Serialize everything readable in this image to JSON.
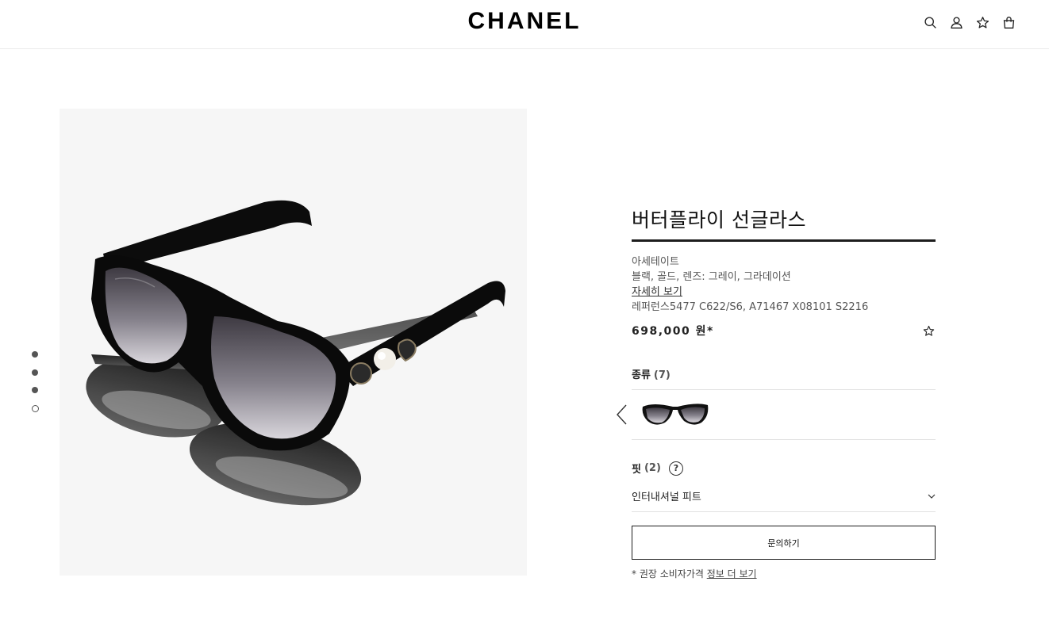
{
  "header": {
    "logo": "CHANEL",
    "icons": [
      "search-icon",
      "account-icon",
      "wishlist-star-icon",
      "shopping-bag-icon"
    ]
  },
  "gallery": {
    "dot_count": 4,
    "active_index": 3,
    "image_alt_icon": "sunglasses-image"
  },
  "product": {
    "title": "버터플라이 선글라스",
    "material": "아세테이트",
    "colors": "블랙, 골드, 렌즈: 그레이, 그라데이션",
    "details_link": "자세히 보기",
    "reference": "레퍼런스5477 C622/S6, A71467 X08101 S2216",
    "price": "698,000 원*"
  },
  "variants": {
    "label": "종류",
    "count": "(7)"
  },
  "fit": {
    "label": "핏",
    "count": "(2)",
    "help": "?",
    "selected": "인터내셔널 피트"
  },
  "actions": {
    "inquire_label": "문의하기"
  },
  "footnote": {
    "text": "* 권장 소비자가격 ",
    "link": "정보 더 보기"
  },
  "colors": {
    "text": "#1d1d1d",
    "image_bg": "#f6f6f6",
    "border": "#e2e2e2"
  }
}
